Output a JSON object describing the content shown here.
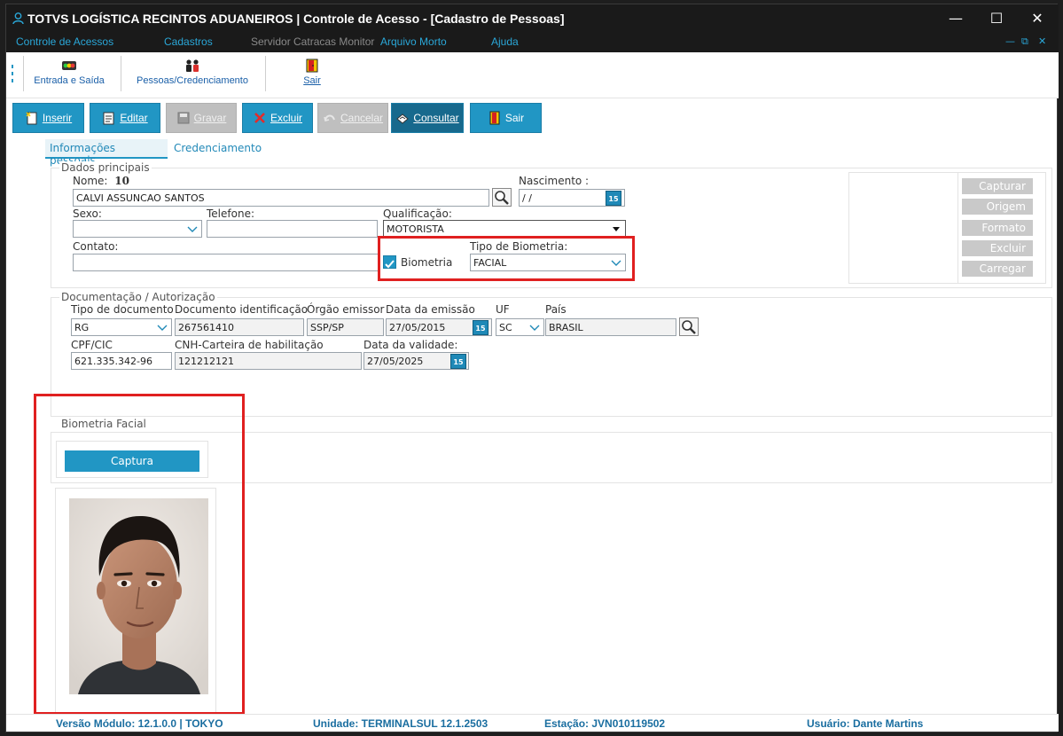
{
  "window": {
    "title": "TOTVS LOGÍSTICA RECINTOS ADUANEIROS | Controle de Acesso - [Cadastro de Pessoas]",
    "controls": {
      "minimize": "—",
      "maximize": "☐",
      "close": "✕"
    }
  },
  "menu": {
    "items": [
      {
        "label": "Controle de Acessos",
        "enabled": true
      },
      {
        "label": "Cadastros",
        "enabled": true
      },
      {
        "label": "Servidor Catracas Monitor",
        "enabled": false
      },
      {
        "label": "Arquivo Morto",
        "enabled": true
      },
      {
        "label": "Ajuda",
        "enabled": true
      }
    ],
    "mdi_controls": {
      "minimize": "—",
      "restore": "⧉",
      "close": "✕"
    }
  },
  "toolbar1": {
    "entrada_saida": "Entrada e Saída",
    "pessoas": "Pessoas/Credenciamento",
    "sair": "Sair"
  },
  "toolbar2": {
    "inserir": "Inserir",
    "editar": "Editar",
    "gravar": "Gravar",
    "excluir": "Excluir",
    "cancelar": "Cancelar",
    "consultar": "Consultar",
    "sair": "Sair"
  },
  "tabs": [
    {
      "label": "Informações pessoais",
      "active": true
    },
    {
      "label": "Credenciamento",
      "active": false
    }
  ],
  "dados_principais": {
    "legend": "Dados principais",
    "nome_label": "Nome:",
    "nome_code": "10",
    "nome_value": "CALVI ASSUNCAO SANTOS",
    "nascimento_label": "Nascimento :",
    "nascimento_value": " /  /",
    "sexo_label": "Sexo:",
    "sexo_value": "",
    "telefone_label": "Telefone:",
    "telefone_value": "",
    "qualificacao_label": "Qualificação:",
    "qualificacao_value": "MOTORISTA",
    "contato_label": "Contato:",
    "contato_value": "",
    "biometria_label": "Biometria",
    "biometria_checked": true,
    "tipo_biometria_label": "Tipo de Biometria:",
    "tipo_biometria_value": "FACIAL"
  },
  "photo_actions": {
    "capturar": "Capturar",
    "origem": "Origem",
    "formato": "Formato",
    "excluir": "Excluir",
    "carregar": "Carregar"
  },
  "documentacao": {
    "legend": "Documentação / Autorização",
    "tipo_doc_label": "Tipo de documento",
    "tipo_doc_value": "RG",
    "doc_id_label": "Documento identificação",
    "doc_id_value": "267561410",
    "orgao_label": "Órgão emissor",
    "orgao_value": "SSP/SP",
    "emissao_label": "Data da emissão",
    "emissao_value": "27/05/2015",
    "uf_label": "UF",
    "uf_value": "SC",
    "pais_label": "País",
    "pais_value": "BRASIL",
    "cpf_label": "CPF/CIC",
    "cpf_value": "621.335.342-96",
    "cnh_label": "CNH-Carteira de habilitação",
    "cnh_value": "121212121",
    "validade_label": "Data da validade:",
    "validade_value": "27/05/2025",
    "calendar_glyph": "15"
  },
  "biometria_facial": {
    "legend": "Biometria Facial",
    "captura_button": "Captura"
  },
  "status": {
    "versao": "Versão Módulo:  12.1.0.0  |  TOKYO",
    "unidade": "Unidade: TERMINALSUL 12.1.2503",
    "estacao": "Estação: JVN010119502",
    "usuario": "Usuário: Dante Martins"
  },
  "colors": {
    "accent": "#2196c4",
    "highlight_box": "#e02020",
    "titlebar": "#1a1a1a",
    "disabled": "#bfbfbf"
  }
}
